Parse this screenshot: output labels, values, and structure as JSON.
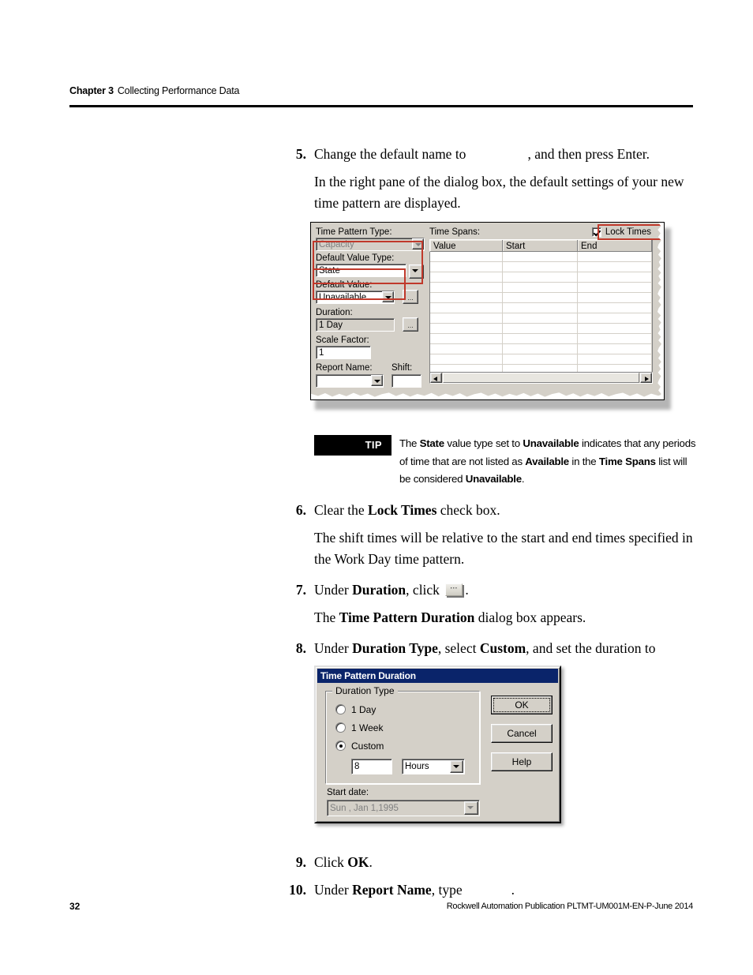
{
  "header": {
    "chapter": "Chapter 3",
    "title": "Collecting Performance Data"
  },
  "steps": {
    "s5": {
      "num": "5.",
      "text_before": "Change the default name to",
      "text_after": ", and then press Enter.",
      "sub": "In the right pane of the dialog box, the default settings of your new time pattern are displayed."
    },
    "s6": {
      "num": "6.",
      "text_before": "Clear the ",
      "bold": "Lock Times",
      "text_after": " check box.",
      "sub": "The shift times will be relative to the start and end times specified in the Work Day time pattern."
    },
    "s7": {
      "num": "7.",
      "text_before": "Under ",
      "bold": "Duration",
      "text_mid": ", click ",
      "text_after": ".",
      "sub_before": "The ",
      "sub_bold": "Time Pattern Duration",
      "sub_after": " dialog box appears."
    },
    "s8": {
      "num": "8.",
      "text_before": "Under ",
      "bold1": "Duration Type",
      "text_mid": ", select ",
      "bold2": "Custom",
      "text_after": ", and set the duration to"
    },
    "s9": {
      "num": "9.",
      "text_before": "Click ",
      "bold": "OK",
      "text_after": "."
    },
    "s10": {
      "num": "10.",
      "text_before": "Under ",
      "bold": "Report Name",
      "text_mid": ", type",
      "text_after": "."
    }
  },
  "tip": {
    "badge": "TIP",
    "p1": "The ",
    "b1": "State",
    "p2": " value type set to ",
    "b2": "Unavailable",
    "p3": " indicates that any periods of time that are not listed as ",
    "b3": "Available",
    "p4": " in the ",
    "b4": "Time Spans",
    "p5": " list will be considered ",
    "b5": "Unavailable",
    "p6": "."
  },
  "screenshot_time_pattern": {
    "labels": {
      "time_pattern_type": "Time Pattern Type:",
      "default_value_type": "Default Value Type:",
      "default_value": "Default Value:",
      "duration": "Duration:",
      "scale_factor": "Scale Factor:",
      "report_name": "Report Name:",
      "shift": "Shift:",
      "time_spans": "Time Spans:"
    },
    "values": {
      "time_pattern_type": "Capacity",
      "default_value_type": "State",
      "default_value": "Unavailable",
      "duration": "1 Day",
      "scale_factor": "1",
      "report_name": "",
      "shift": ""
    },
    "lock_times": {
      "label": "Lock Times",
      "checked": true
    },
    "grid": {
      "columns": [
        "Value",
        "Start",
        "End"
      ],
      "rows": []
    },
    "ellipsis_label": "...",
    "highlight_color": "#c0392b"
  },
  "screenshot_duration_dialog": {
    "title": "Time Pattern Duration",
    "group_legend": "Duration Type",
    "radios": [
      {
        "label": "1 Day",
        "selected": false
      },
      {
        "label": "1 Week",
        "selected": false
      },
      {
        "label": "Custom",
        "selected": true
      }
    ],
    "custom_value": "8",
    "custom_unit": "Hours",
    "start_date_label": "Start date:",
    "start_date_value": "Sun , Jan  1,1995",
    "buttons": {
      "ok": "OK",
      "cancel": "Cancel",
      "help": "Help"
    },
    "titlebar_color": "#0a246a"
  },
  "footer": {
    "page": "32",
    "publication": "Rockwell Automation Publication PLTMT-UM001M-EN-P-June 2014"
  }
}
